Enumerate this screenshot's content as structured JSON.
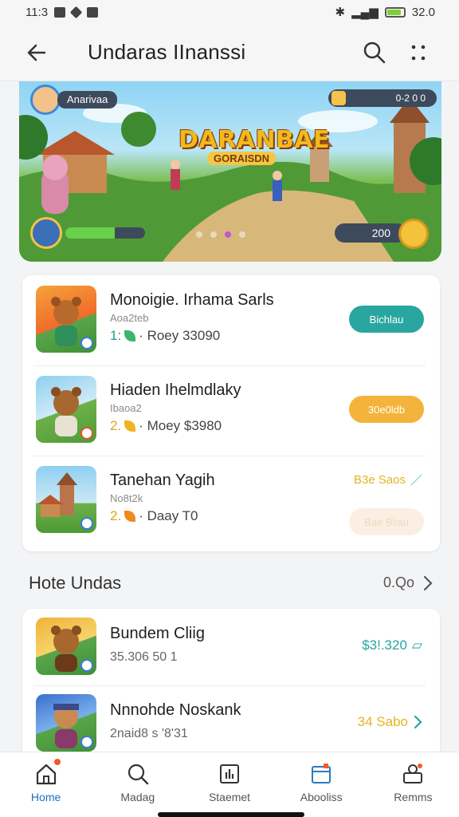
{
  "status_bar": {
    "time": "11:3",
    "battery": "32.0"
  },
  "app_bar": {
    "title": "Undaras IInanssi"
  },
  "banner": {
    "player_name": "Anarivaa",
    "coins": "0-2 0 0",
    "game_title": "DARANBAE",
    "game_subtitle": "GORAISDN",
    "score": "200",
    "energy_level": 0.62,
    "carousel_pages": 4,
    "carousel_active": 2
  },
  "top_list": [
    {
      "title": "Monoigie. Irhama Sarls",
      "subtitle": "Aoa2teb",
      "meta_num": "1:",
      "meta_text": "· Roey  33090",
      "action": "Bichlau",
      "action_style": "teal"
    },
    {
      "title": "Hiaden Ihelmdlaky",
      "subtitle": "Ibaoa2",
      "meta_num": "2.",
      "meta_text": "· Moey  $3980",
      "action": "30e0ldb",
      "action_style": "orange"
    },
    {
      "title": "Tanehan Yagih",
      "subtitle": "No8t2k",
      "meta_num": "2.",
      "meta_text": "· Daay  T0",
      "price": "B3e Saos",
      "action": "Bae Bliau",
      "action_style": "ghost"
    }
  ],
  "section": {
    "title": "Hote Undas",
    "more": "0.Qo"
  },
  "bottom_list": [
    {
      "title": "Bundem Cliig",
      "subtitle": "35.306 50 1",
      "price": "$3!.320",
      "price_style": "teal"
    },
    {
      "title": "Nnnohde Noskank",
      "subtitle": "2naid8 s '8'31",
      "price": "34 Sabo",
      "price_style": "gold"
    }
  ],
  "bottom_nav": [
    {
      "label": "Home",
      "icon": "home-icon",
      "active": true
    },
    {
      "label": "Madag",
      "icon": "search-icon",
      "active": false
    },
    {
      "label": "Staemet",
      "icon": "chart-icon",
      "active": false
    },
    {
      "label": "Abooliss",
      "icon": "calendar-icon",
      "active": false
    },
    {
      "label": "Remms",
      "icon": "profile-icon",
      "active": false
    }
  ],
  "colors": {
    "accent": "#2aa6a1",
    "orange": "#f4b33b",
    "active_nav": "#1f6fbf"
  }
}
